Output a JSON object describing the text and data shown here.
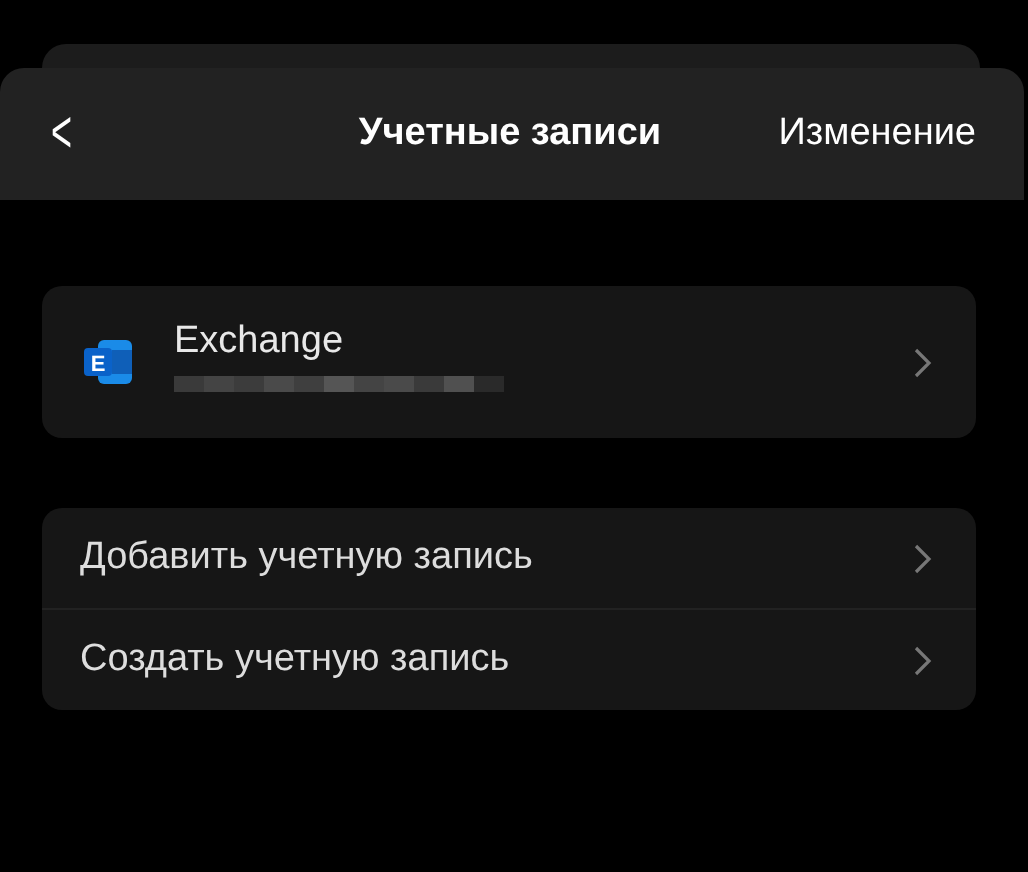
{
  "header": {
    "back": "<",
    "title": "Учетные записи",
    "edit": "Изменение"
  },
  "accounts": [
    {
      "kind": "exchange",
      "name": "Exchange",
      "icon_letter": "E",
      "email_hidden": true
    }
  ],
  "actions": [
    {
      "label": "Добавить учетную запись"
    },
    {
      "label": "Создать учетную запись"
    }
  ]
}
